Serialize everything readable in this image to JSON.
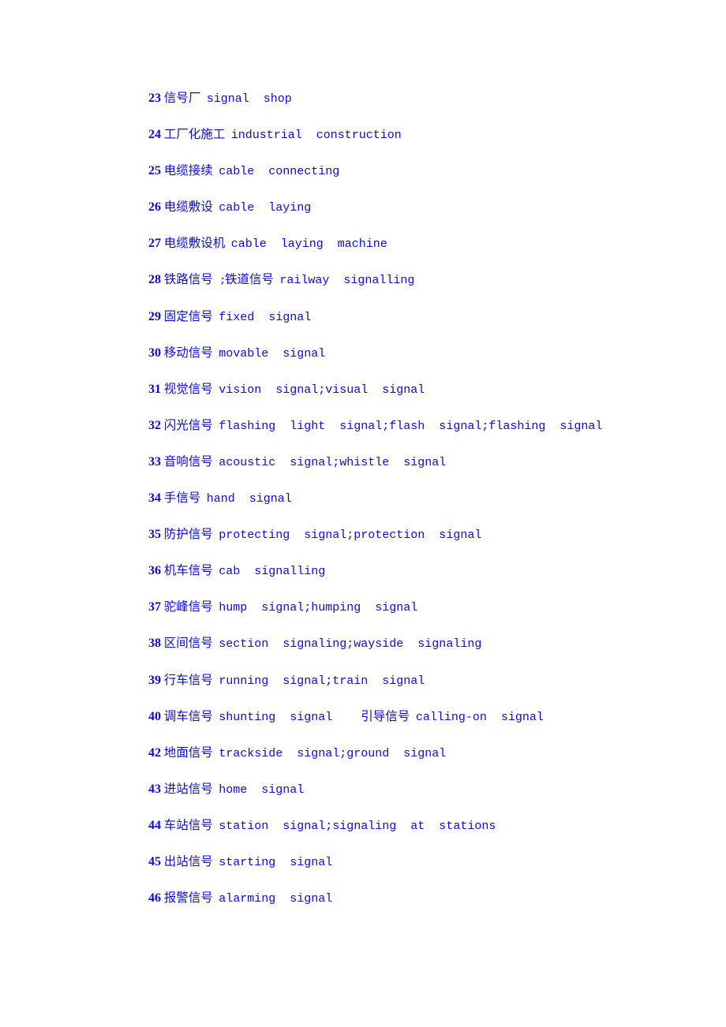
{
  "text_color": "#0a0ae6",
  "entries": [
    {
      "num": "23",
      "zh": "信号厂",
      "en": "signal  shop"
    },
    {
      "num": "24",
      "zh": "工厂化施工",
      "en": "industrial  construction"
    },
    {
      "num": "25",
      "zh": "电缆接续",
      "en": "cable  connecting"
    },
    {
      "num": "26",
      "zh": "电缆敷设",
      "en": "cable  laying"
    },
    {
      "num": "27",
      "zh": "电缆敷设机",
      "en": "cable  laying  machine"
    },
    {
      "num": "28",
      "zh": "铁路信号  ;铁道信号",
      "en": "railway  signalling"
    },
    {
      "num": "29",
      "zh": "固定信号",
      "en": "fixed  signal"
    },
    {
      "num": "30",
      "zh": "移动信号",
      "en": "movable  signal"
    },
    {
      "num": "31",
      "zh": "视觉信号",
      "en": "vision  signal;visual  signal"
    },
    {
      "num": "32",
      "zh": "闪光信号",
      "en": "flashing  light  signal;flash  signal;flashing  signal"
    },
    {
      "num": "33",
      "zh": "音响信号",
      "en": "acoustic  signal;whistle  signal"
    },
    {
      "num": "34",
      "zh": "手信号",
      "en": "hand  signal"
    },
    {
      "num": "35",
      "zh": "防护信号",
      "en": "protecting  signal;protection  signal"
    },
    {
      "num": "36",
      "zh": "机车信号",
      "en": "cab  signalling"
    },
    {
      "num": "37",
      "zh": "驼峰信号",
      "en": "hump  signal;humping  signal"
    },
    {
      "num": "38",
      "zh": "区间信号",
      "en": "section  signaling;wayside  signaling"
    },
    {
      "num": "39",
      "zh": "行车信号",
      "en": "running  signal;train  signal"
    },
    {
      "num": "40",
      "zh": "调车信号",
      "en": "shunting  signal    ",
      "zh2": "引导信号",
      "en2": "calling-on  signal"
    },
    {
      "num": "42",
      "zh": "地面信号",
      "en": "trackside  signal;ground  signal"
    },
    {
      "num": "43",
      "zh": "进站信号",
      "en": "home  signal"
    },
    {
      "num": "44",
      "zh": "车站信号",
      "en": "station  signal;signaling  at  stations"
    },
    {
      "num": "45",
      "zh": "出站信号",
      "en": "starting  signal"
    },
    {
      "num": "46",
      "zh": "报警信号",
      "en": "alarming  signal"
    }
  ]
}
